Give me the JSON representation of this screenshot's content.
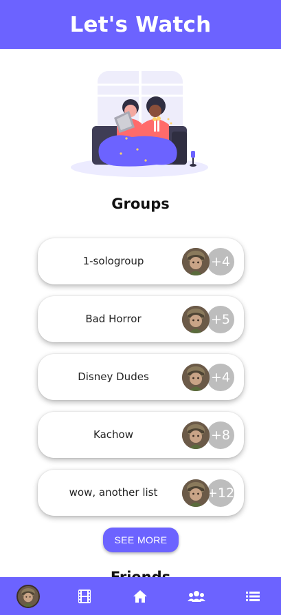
{
  "header": {
    "title": "Let's Watch"
  },
  "groups": {
    "title": "Groups",
    "items": [
      {
        "name": "1-sologroup",
        "extra_members": "+4"
      },
      {
        "name": "Bad Horror",
        "extra_members": "+5"
      },
      {
        "name": "Disney Dudes",
        "extra_members": "+4"
      },
      {
        "name": "Kachow",
        "extra_members": "+8"
      },
      {
        "name": "wow, another list",
        "extra_members": "+12"
      }
    ],
    "see_more_label": "SEE MORE"
  },
  "friends": {
    "title": "Friends"
  },
  "nav": {
    "items": [
      {
        "icon": "profile-avatar"
      },
      {
        "icon": "film-icon"
      },
      {
        "icon": "home-icon"
      },
      {
        "icon": "people-icon"
      },
      {
        "icon": "list-icon"
      }
    ]
  },
  "colors": {
    "primary": "#6c63ff",
    "bubble": "#bdbdbd",
    "white": "#ffffff"
  }
}
